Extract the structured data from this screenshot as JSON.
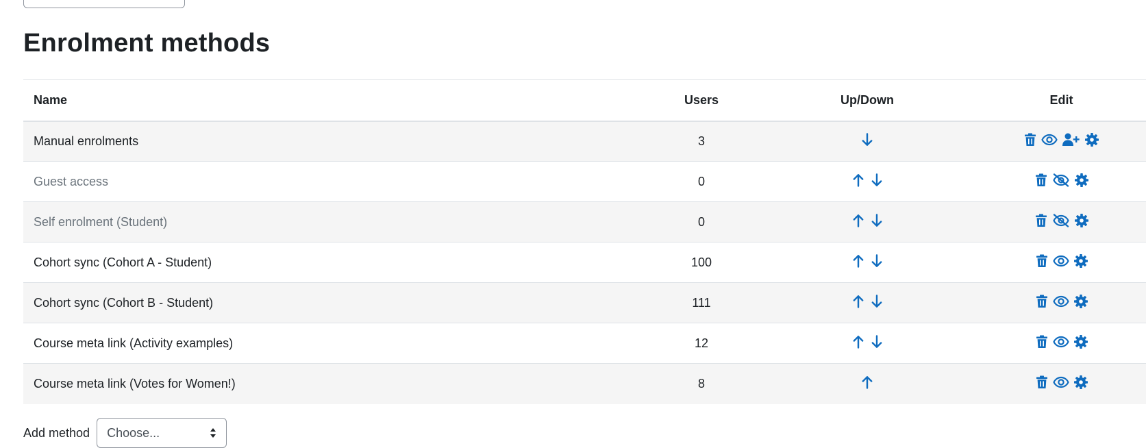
{
  "page": {
    "title": "Enrolment methods"
  },
  "table": {
    "headers": {
      "name": "Name",
      "users": "Users",
      "updown": "Up/Down",
      "edit": "Edit"
    },
    "rows": [
      {
        "name": "Manual enrolments",
        "users": "3",
        "dimmed": false,
        "up": false,
        "down": true,
        "visible": true,
        "enrol_users": true
      },
      {
        "name": "Guest access",
        "users": "0",
        "dimmed": true,
        "up": true,
        "down": true,
        "visible": false,
        "enrol_users": false
      },
      {
        "name": "Self enrolment (Student)",
        "users": "0",
        "dimmed": true,
        "up": true,
        "down": true,
        "visible": false,
        "enrol_users": false
      },
      {
        "name": "Cohort sync (Cohort A - Student)",
        "users": "100",
        "dimmed": false,
        "up": true,
        "down": true,
        "visible": true,
        "enrol_users": false
      },
      {
        "name": "Cohort sync (Cohort B - Student)",
        "users": "111",
        "dimmed": false,
        "up": true,
        "down": true,
        "visible": true,
        "enrol_users": false
      },
      {
        "name": "Course meta link (Activity examples)",
        "users": "12",
        "dimmed": false,
        "up": true,
        "down": true,
        "visible": true,
        "enrol_users": false
      },
      {
        "name": "Course meta link (Votes for Women!)",
        "users": "8",
        "dimmed": false,
        "up": true,
        "down": false,
        "visible": true,
        "enrol_users": false
      }
    ]
  },
  "add_method": {
    "label": "Add method",
    "selected": "Choose..."
  },
  "colors": {
    "accent": "#0f6cbf",
    "text": "#1d2125",
    "dimmed": "#6a737b",
    "stripe": "#f5f5f5"
  },
  "icons": [
    "trash-icon",
    "eye-icon",
    "eye-slash-icon",
    "user-plus-icon",
    "gear-icon",
    "arrow-up-icon",
    "arrow-down-icon"
  ]
}
